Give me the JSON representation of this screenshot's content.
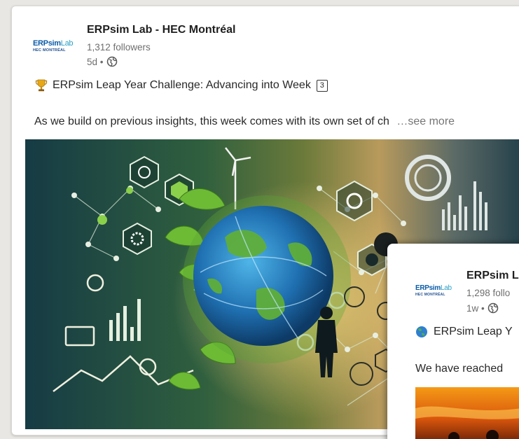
{
  "main_post": {
    "logo": {
      "line1_a": "ERPsim",
      "line1_b": "Lab",
      "line2": "HEC MONTRÉAL"
    },
    "author": "ERPsim Lab - HEC Montréal",
    "followers": "1,312 followers",
    "time": "5d •",
    "headline": "ERPsim Leap Year Challenge: Advancing into Week",
    "week_number": "3",
    "body": "As we build on previous insights, this week comes with its own set of ch",
    "see_more": "…see more",
    "icons": [
      "trophy-icon",
      "globe-icon",
      "keycap-icon"
    ]
  },
  "overlay_post": {
    "logo": {
      "line1_a": "ERPsim",
      "line1_b": "Lab",
      "line2": "HEC MONTRÉAL"
    },
    "author": "ERPsim L",
    "followers": "1,298 follo",
    "time": "1w •",
    "headline": "ERPsim Leap Y",
    "body": "We have reached",
    "icons": [
      "earth-icon",
      "globe-icon"
    ]
  },
  "colors": {
    "logo_blue": "#0a5ba8",
    "logo_cyan": "#2aa0c6",
    "image_teal": "#1f4a4e",
    "image_green": "#5ea23a",
    "image_amber": "#c9a05a"
  }
}
